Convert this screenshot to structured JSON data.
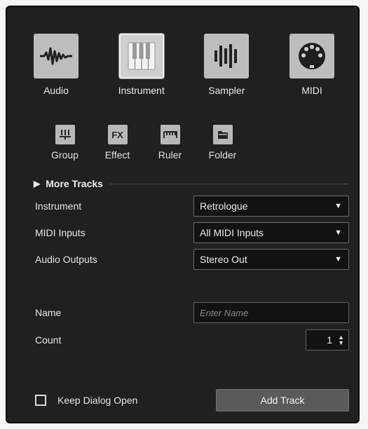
{
  "track_types": [
    {
      "label": "Audio",
      "icon": "waveform-icon",
      "selected": false
    },
    {
      "label": "Instrument",
      "icon": "piano-keys-icon",
      "selected": true
    },
    {
      "label": "Sampler",
      "icon": "sampler-bars-icon",
      "selected": false
    },
    {
      "label": "MIDI",
      "icon": "midi-connector-icon",
      "selected": false
    }
  ],
  "small_types": [
    {
      "label": "Group",
      "icon": "group-icon"
    },
    {
      "label": "Effect",
      "icon": "fx-icon",
      "glyph": "FX"
    },
    {
      "label": "Ruler",
      "icon": "ruler-icon"
    },
    {
      "label": "Folder",
      "icon": "folder-icon"
    }
  ],
  "more_tracks": {
    "label": "More Tracks"
  },
  "fields": {
    "instrument": {
      "label": "Instrument",
      "value": "Retrologue"
    },
    "midi_inputs": {
      "label": "MIDI Inputs",
      "value": "All MIDI Inputs"
    },
    "audio_outputs": {
      "label": "Audio Outputs",
      "value": "Stereo Out"
    },
    "name": {
      "label": "Name",
      "placeholder": "Enter Name"
    },
    "count": {
      "label": "Count",
      "value": "1"
    }
  },
  "keep_open": {
    "label": "Keep Dialog Open",
    "checked": false
  },
  "add_button": {
    "label": "Add Track"
  },
  "colors": {
    "dialog_bg": "#1f2022",
    "icon_bg": "#bdbdbd",
    "button_bg": "#5a5a5a"
  }
}
